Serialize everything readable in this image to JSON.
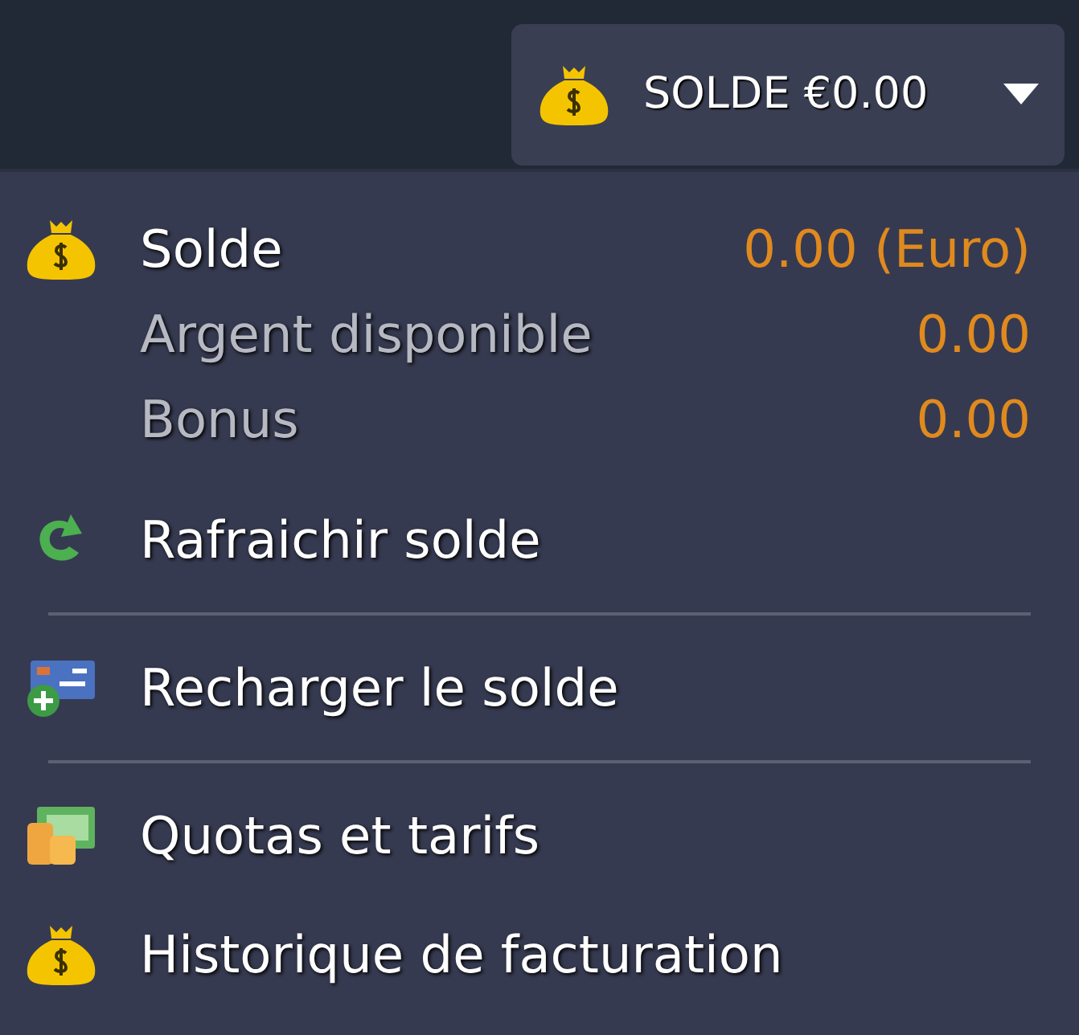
{
  "balance_button": {
    "label": "SOLDE €0.00"
  },
  "menu": [
    {
      "kind": "header",
      "label": "Solde",
      "value": "0.00 (Euro)"
    },
    {
      "kind": "detail",
      "label": "Argent disponible",
      "value": "0.00"
    },
    {
      "kind": "detail",
      "label": "Bonus",
      "value": "0.00"
    },
    {
      "kind": "refresh",
      "label": "Rafraichir solde"
    },
    {
      "kind": "divider"
    },
    {
      "kind": "topup",
      "label": "Recharger le solde"
    },
    {
      "kind": "divider"
    },
    {
      "kind": "pricing",
      "label": "Quotas et tarifs"
    },
    {
      "kind": "history",
      "label": "Historique de facturation"
    }
  ]
}
